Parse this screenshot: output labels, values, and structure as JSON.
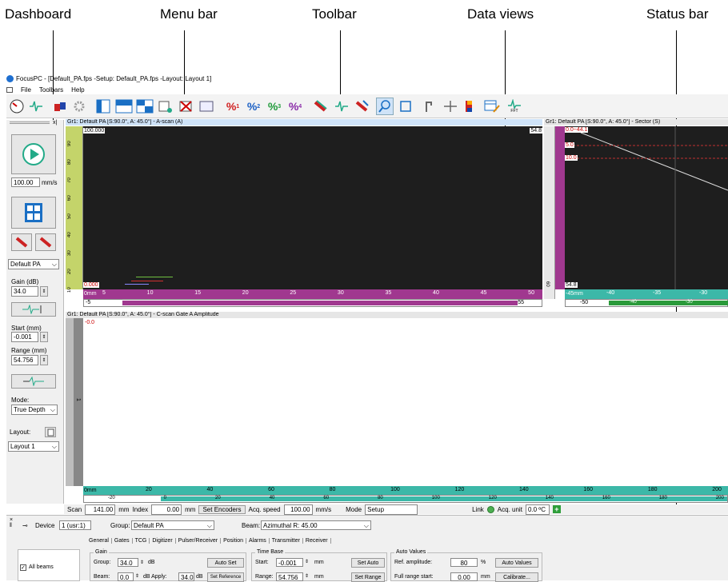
{
  "callouts": {
    "dashboard": "Dashboard",
    "menu_bar": "Menu bar",
    "toolbar": "Toolbar",
    "data_views": "Data views",
    "status_bar": "Status bar"
  },
  "window": {
    "title": "FocusPC - [Default_PA.fps -Setup: Default_PA.fps -Layout: Layout 1]"
  },
  "menu": [
    "File",
    "Toolbars",
    "Help"
  ],
  "toolbar": {
    "pct_labels": [
      "%",
      "%",
      "%",
      "%"
    ],
    "pct_subs": [
      "1",
      "2",
      "3",
      "4"
    ],
    "fft_label": "FFT"
  },
  "dashboard": {
    "speed_value": "100.00",
    "speed_unit": "mm/s",
    "group_select": "Default PA",
    "gain_label": "Gain (dB)",
    "gain_value": "34.0",
    "start_label": "Start (mm)",
    "start_value": "-0.001",
    "range_label": "Range (mm)",
    "range_value": "54.756",
    "mode_label": "Mode:",
    "mode_value": "True Depth",
    "layout_label": "Layout:",
    "layout_value": "Layout 1"
  },
  "views": {
    "ascan_title": "Gr1: Default PA [S:90.0°, A: 45.0°] - A-scan (A)",
    "ascan_top_value": "100.000",
    "ascan_bottom_value": "0.000",
    "ascan_right_value": "54.8",
    "ascan_axis_unit": "0mm",
    "ascan_ticks": [
      "5",
      "10",
      "15",
      "20",
      "25",
      "30",
      "35",
      "40",
      "45",
      "50"
    ],
    "ascan_lower_left": "-5",
    "ascan_lower_right": "55",
    "ascan_left_ticks": [
      "90",
      "80",
      "70",
      "60",
      "50",
      "40",
      "30",
      "20",
      "10"
    ],
    "sector_title": "Gr1: Default PA [S:90.0°, A: 45.0°] - Sector (S)",
    "sector_top": "0.0~44.1",
    "sector_marker1": "5.0",
    "sector_marker2": "10.0",
    "sector_bottom": "54.8",
    "sector_axis_unit": "-45mm",
    "sector_ticks": [
      "-40",
      "-35",
      "-30"
    ],
    "sector_lower_ticks": [
      "-50",
      "-40",
      "-30"
    ],
    "sector_left_labels": [
      "60"
    ],
    "cscan_title": "Gr1: Default PA [S:90.0°, A: 45.0°] - C-scan Gate A Amplitude",
    "cscan_marker": "-0.0",
    "cscan_axis_unit": "0mm",
    "cscan_ticks": [
      "20",
      "40",
      "60",
      "80",
      "100",
      "120",
      "140",
      "160",
      "180",
      "200"
    ],
    "cscan_lower_ticks": [
      "-20",
      "0",
      "20",
      "40",
      "60",
      "80",
      "100",
      "120",
      "140",
      "160",
      "180",
      "200"
    ],
    "cscan_left_label": "1"
  },
  "status": {
    "scan_label": "Scan",
    "scan_value": "141.00",
    "scan_unit": "mm",
    "index_label": "Index",
    "index_value": "0.00",
    "index_unit": "mm",
    "set_encoders": "Set Encoders",
    "acq_speed_label": "Acq. speed",
    "acq_speed_value": "100.00",
    "acq_speed_unit": "mm/s",
    "mode_label": "Mode",
    "mode_value": "Setup",
    "link_label": "Link",
    "acq_unit_label": "Acq. unit",
    "acq_unit_value": "0.0 ºC",
    "colors": {
      "link": "#4caf50",
      "plus": "#2e9e3a"
    }
  },
  "bottom": {
    "device_label": "Device",
    "device_value": "1 (usr:1)",
    "group_label": "Group:",
    "group_value": "Default PA",
    "beam_label": "Beam:",
    "beam_value": "Azimuthal  R: 45.00",
    "tabs": [
      "General",
      "Gates",
      "TCG",
      "Digitizer",
      "Pulser/Receiver",
      "Position",
      "Alarms",
      "Transmitter",
      "Receiver"
    ],
    "all_beams": "All beams",
    "gain_group": "Gain",
    "gain_group_label": "Group:",
    "gain_group_value": "34.0",
    "gain_unit": "dB",
    "auto_set": "Auto Set",
    "gain_beam_label": "Beam:",
    "gain_beam_value": "0.0",
    "gain_apply_label": "dB  Apply:",
    "gain_apply_value": "34.0",
    "gain_apply_unit": "dB",
    "set_reference": "Set Reference",
    "time_base": "Time Base",
    "tb_start_label": "Start:",
    "tb_start_value": "-0.001",
    "tb_unit": "mm",
    "set_auto": "Set Auto",
    "tb_range_label": "Range:",
    "tb_range_value": "54.756",
    "set_range": "Set Range",
    "auto_values_group": "Auto Values",
    "ref_amp_label": "Ref. amplitude:",
    "ref_amp_value": "80",
    "ref_amp_unit": "%",
    "auto_values_btn": "Auto Values",
    "full_range_label": "Full range start:",
    "full_range_value": "0.00",
    "full_range_unit": "mm",
    "calibrate": "Calibrate..."
  }
}
